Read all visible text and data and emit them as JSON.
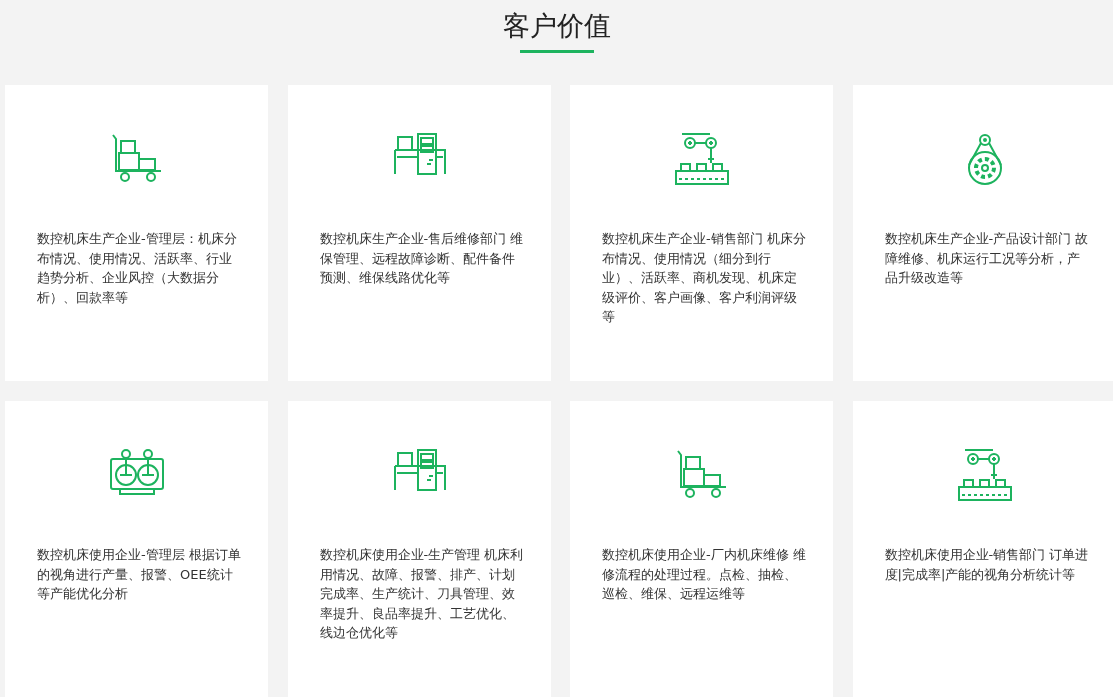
{
  "title": "客户价值",
  "cards": [
    {
      "kind": "cart",
      "text": "数控机床生产企业-管理层：机床分布情况、使用情况、活跃率、行业趋势分析、企业风控（大数据分析）、回款率等"
    },
    {
      "kind": "machine",
      "text": "数控机床生产企业-售后维修部门 维保管理、远程故障诊断、配件备件预测、维保线路优化等"
    },
    {
      "kind": "robot",
      "text": "数控机床生产企业-销售部门 机床分布情况、使用情况（细分到行业）、活跃率、商机发现、机床定级评价、客户画像、客户利润评级等"
    },
    {
      "kind": "gear",
      "text": "数控机床生产企业-产品设计部门 故障维修、机床运行工况等分析，产品升级改造等"
    },
    {
      "kind": "joystick",
      "text": "数控机床使用企业-管理层 根据订单的视角进行产量、报警、OEE统计等产能优化分析"
    },
    {
      "kind": "machine",
      "text": "数控机床使用企业-生产管理 机床利用情况、故障、报警、排产、计划完成率、生产统计、刀具管理、效率提升、良品率提升、工艺优化、线边仓优化等"
    },
    {
      "kind": "cart",
      "text": "数控机床使用企业-厂内机床维修 维修流程的处理过程。点检、抽检、巡检、维保、远程运维等"
    },
    {
      "kind": "robot",
      "text": "数控机床使用企业-销售部门 订单进度|完成率|产能的视角分析统计等"
    }
  ]
}
